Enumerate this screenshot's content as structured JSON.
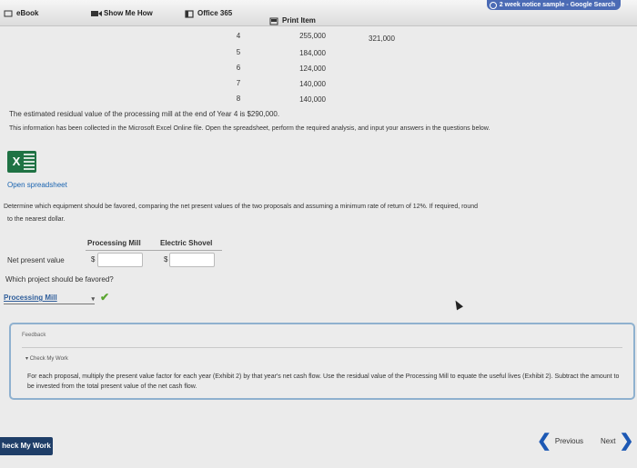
{
  "topbar": {
    "ebook": "eBook",
    "show_me_how": "Show Me How",
    "office365": "Office 365",
    "print_item": "Print Item",
    "search_chip": "2 week notice sample - Google Search"
  },
  "cash_flows": {
    "rows": [
      {
        "year": "4",
        "processing": "255,000",
        "electric": "321,000"
      },
      {
        "year": "5",
        "processing": "184,000"
      },
      {
        "year": "6",
        "processing": "124,000"
      },
      {
        "year": "7",
        "processing": "140,000"
      },
      {
        "year": "8",
        "processing": "140,000"
      }
    ]
  },
  "content": {
    "residual_text": "The estimated residual value of the processing mill at the end of Year 4 is $290,000.",
    "info_text": "This information has been collected in the Microsoft Excel Online file. Open the spreadsheet, perform the required analysis, and input your answers in the questions below.",
    "open_spreadsheet": "Open spreadsheet",
    "question_line1": "Determine which equipment should be favored, comparing the net present values of the two proposals and assuming a minimum rate of return of 12%. If required, round",
    "question_line2": "to the nearest dollar.",
    "col_processing": "Processing Mill",
    "col_electric": "Electric Shovel",
    "npv_label": "Net present value",
    "dollar_sign": "$",
    "favored_question": "Which project should be favored?",
    "favored_answer": "Processing Mill"
  },
  "feedback": {
    "title": "Feedback",
    "check_my_work": "Check My Work",
    "text": "For each proposal, multiply the present value factor for each year (Exhibit 2) by that year's net cash flow. Use the residual value of the Processing Mill to equate the useful lives (Exhibit 2). Subtract the amount to be invested from the total present value of the net cash flow."
  },
  "footer": {
    "check_button": "heck My Work",
    "previous": "Previous",
    "next": "Next"
  },
  "colors": {
    "link": "#1a64b1",
    "check": "#5aa52f",
    "feedback_border": "#8fb1cf",
    "bottom_button": "#1f3e68"
  }
}
